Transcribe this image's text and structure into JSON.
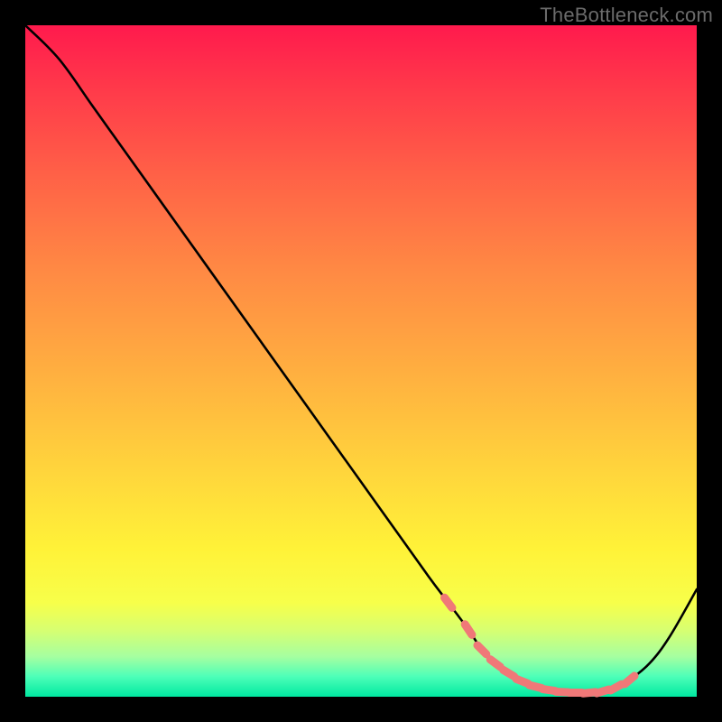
{
  "watermark": "TheBottleneck.com",
  "chart_data": {
    "type": "line",
    "title": "",
    "xlabel": "",
    "ylabel": "",
    "xlim": [
      0,
      100
    ],
    "ylim": [
      0,
      100
    ],
    "grid": false,
    "series": [
      {
        "name": "curve",
        "x": [
          0,
          5,
          10,
          15,
          20,
          25,
          30,
          35,
          40,
          45,
          50,
          55,
          60,
          63,
          66,
          68,
          70,
          72,
          74,
          76,
          78,
          80,
          82,
          84,
          86,
          88,
          90,
          93,
          96,
          100
        ],
        "y": [
          100,
          95,
          88,
          81,
          74,
          67,
          60,
          53,
          46,
          39,
          32,
          25,
          18,
          14,
          10,
          7,
          5,
          3.5,
          2.3,
          1.5,
          1,
          0.7,
          0.6,
          0.6,
          0.8,
          1.4,
          2.5,
          5,
          9,
          16
        ]
      }
    ],
    "segment_markers": {
      "name": "segment-markers",
      "color": "#f07878",
      "points_index_range": [
        13,
        26
      ]
    }
  }
}
